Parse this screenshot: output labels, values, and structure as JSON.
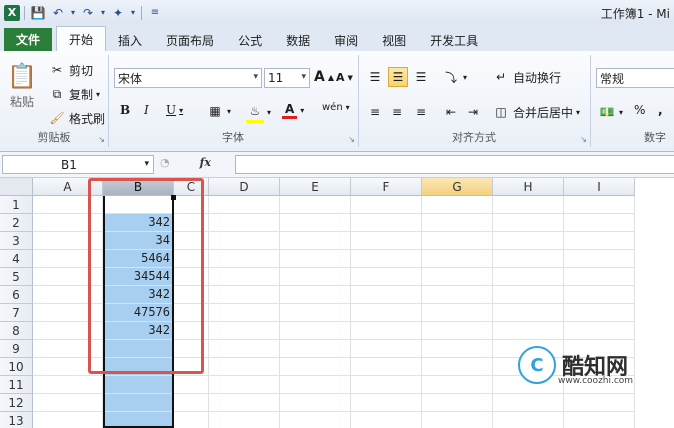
{
  "title_bar": {
    "window_title": "工作簿1 - Mi"
  },
  "qat": {
    "save_icon": "save-icon",
    "undo_icon": "undo-icon",
    "redo_icon": "redo-icon",
    "customize_icon": "customize-icon"
  },
  "tabs": [
    "文件",
    "开始",
    "插入",
    "页面布局",
    "公式",
    "数据",
    "审阅",
    "视图",
    "开发工具"
  ],
  "ribbon": {
    "clipboard": {
      "paste": "粘贴",
      "cut": "剪切",
      "copy": "复制",
      "format_painter": "格式刷",
      "label": "剪贴板"
    },
    "font": {
      "font_name": "宋体",
      "font_size": "11",
      "bold": "B",
      "italic": "I",
      "underline": "U",
      "grow": "A",
      "shrink": "A",
      "font_color": "A",
      "wen": "wén",
      "label": "字体"
    },
    "alignment": {
      "wrap_text": "自动换行",
      "merge_center": "合并后居中",
      "label": "对齐方式"
    },
    "number": {
      "format": "常规",
      "percent": "%",
      "comma": ",",
      "label": "数字"
    }
  },
  "formula_bar": {
    "name_box": "B1",
    "fx": "fx",
    "formula": ""
  },
  "columns": [
    "A",
    "B",
    "C",
    "D",
    "E",
    "F",
    "G",
    "H",
    "I"
  ],
  "rows": [
    "1",
    "2",
    "3",
    "4",
    "5",
    "6",
    "7",
    "8",
    "9",
    "10",
    "11",
    "12",
    "13"
  ],
  "column_b_values": [
    "",
    "342",
    "34",
    "5464",
    "34544",
    "342",
    "47576",
    "342",
    "",
    "",
    "",
    "",
    ""
  ],
  "colors": {
    "selection": "#a9cff0",
    "highlight_box": "#d9534f",
    "file_tab": "#2b7d3a"
  },
  "watermark": {
    "name": "酷知网",
    "url": "www.coozhi.com"
  }
}
